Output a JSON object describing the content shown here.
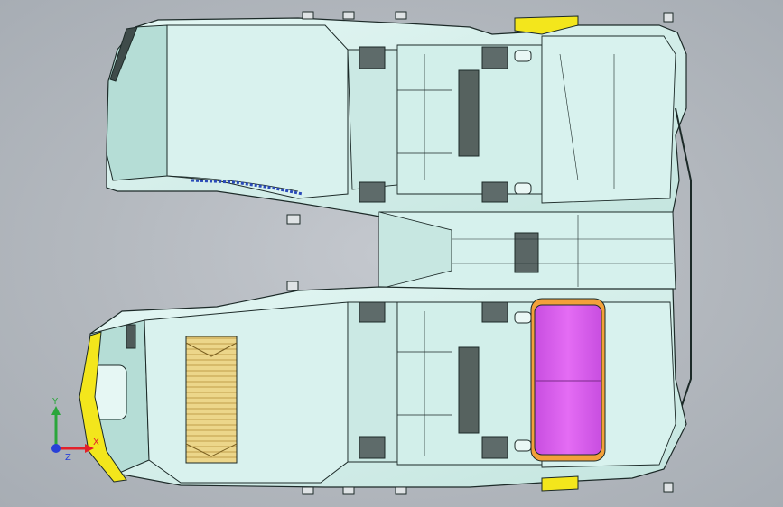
{
  "window": {
    "title": ""
  },
  "viewport": {
    "view": "top",
    "display_mode": "shaded-with-edges"
  },
  "colors": {
    "background_center": "#c4c8ce",
    "background_edge": "#a7adb4",
    "body_fill": "#cdebe6",
    "body_fill_light": "#def5f2",
    "body_shadow": "#9fc4bd",
    "edge": "#1c2a28",
    "dark_panel": "#4a5655",
    "yellow_part": "#f3e61c",
    "magenta_part": "#e05ef0",
    "orange_rim": "#f3a03a",
    "wood_pad": "#e8cf7b",
    "triad_x": "#e3202a",
    "triad_y": "#2aa63b",
    "triad_z": "#2840d8"
  },
  "triad": {
    "x_label": "X",
    "y_label": "Y",
    "z_label": "Z"
  },
  "parts": [
    {
      "name": "floor-panel",
      "color": "body_fill"
    },
    {
      "name": "seat-pad",
      "color": "wood_pad"
    },
    {
      "name": "battery-box",
      "color": "magenta_part"
    },
    {
      "name": "bumper-trim",
      "color": "yellow_part"
    }
  ]
}
